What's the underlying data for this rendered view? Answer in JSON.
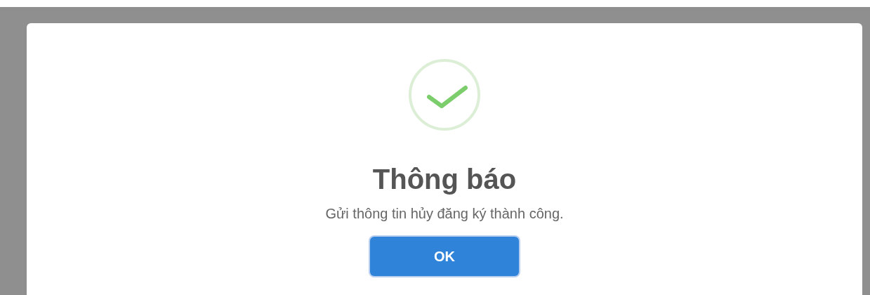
{
  "dialog": {
    "kind": "success",
    "title": "Thông báo",
    "message": "Gửi thông tin hủy đăng ký thành công.",
    "button": "OK"
  }
}
